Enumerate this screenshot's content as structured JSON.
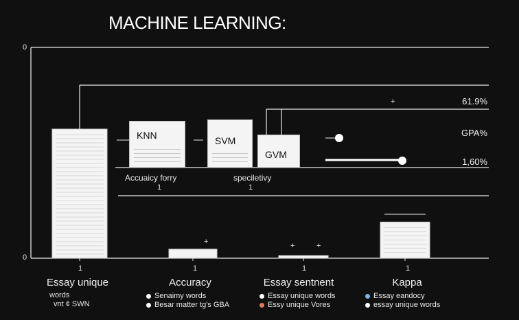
{
  "chart_data": {
    "type": "bar",
    "title": "MACHINE LEARNING:",
    "categories": [
      "Essay unique words",
      "Accuracy",
      "Essay sentiment",
      "Kappa"
    ],
    "category_labels": [
      "Essay unique",
      "Accuracy",
      "Essay sentnent",
      "Kappa"
    ],
    "category_sublabels": [
      "words",
      "",
      "",
      ""
    ],
    "values": [
      1.0,
      0.07,
      0.02,
      0.28
    ],
    "ylim": [
      0,
      1
    ],
    "y_ticks": [
      "0",
      "0"
    ],
    "x_tick_marks": [
      "1",
      "1",
      "1",
      "1"
    ],
    "grid": true,
    "annotations": {
      "models": [
        "KNN",
        "SVM",
        "GVM"
      ],
      "row_labels": [
        "Accuaicy forry",
        "speciletivy"
      ],
      "row_marks": [
        "1",
        "1"
      ],
      "right_values": [
        "61.9%",
        "GPA%",
        "1,60%"
      ],
      "plus_marks": [
        "+",
        "+",
        "+",
        "+"
      ]
    },
    "legends": [
      {
        "items": [
          {
            "text": "vnt ¢ SWN",
            "color": "#ffffff"
          }
        ],
        "prefix": "vnt ¢ SWN"
      },
      {
        "items": [
          {
            "text": "Senaimy words",
            "color": "#ffffff"
          },
          {
            "text": "Besar matter tg's GBA",
            "color": "#ffffff"
          }
        ]
      },
      {
        "items": [
          {
            "text": "Essay unique words",
            "color": "#ffffff"
          },
          {
            "text": "Essy unique Vores",
            "color": "#e07a5f"
          }
        ]
      },
      {
        "items": [
          {
            "text": "Essay eandocy",
            "color": "#7fb2e5"
          },
          {
            "text": "essay unique words",
            "color": "#ffffff"
          }
        ]
      }
    ]
  }
}
